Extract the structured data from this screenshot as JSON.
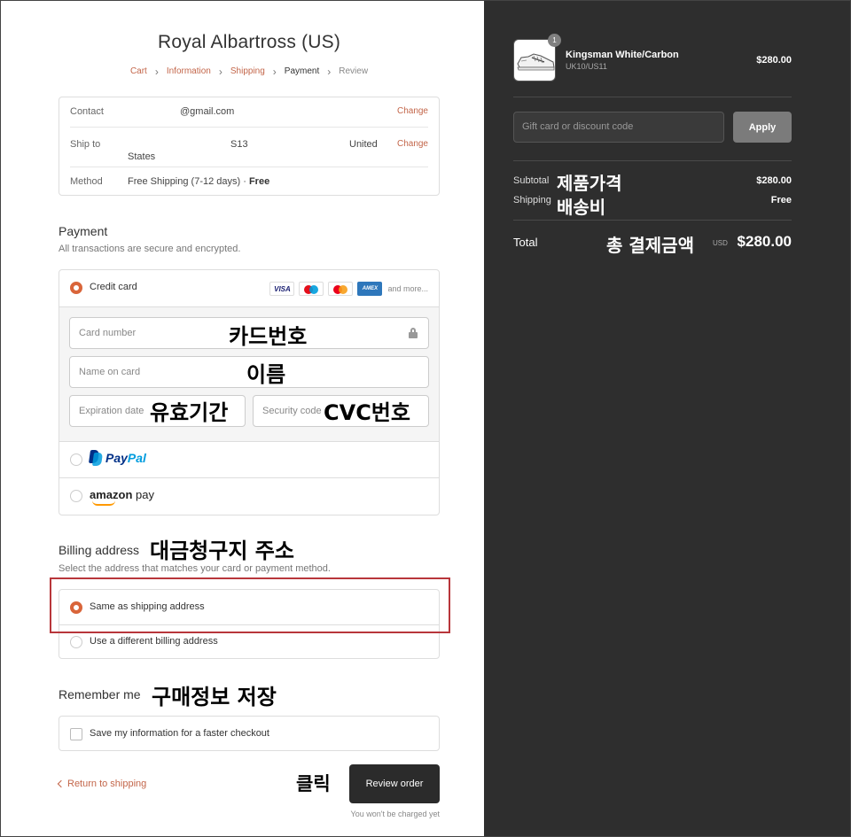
{
  "store": {
    "title": "Royal Albartross (US)"
  },
  "breadcrumb": {
    "cart": "Cart",
    "information": "Information",
    "shipping": "Shipping",
    "payment": "Payment",
    "review": "Review",
    "separator": "›"
  },
  "info": {
    "contact_label": "Contact",
    "contact_value": "@gmail.com",
    "ship_label": "Ship to",
    "ship_s13": "S13",
    "ship_united": "United",
    "ship_states": "States",
    "method_label": "Method",
    "method_value": "Free Shipping (7-12 days) · ",
    "method_free": "Free",
    "change": "Change"
  },
  "payment": {
    "title": "Payment",
    "subtitle": "All transactions are secure and encrypted.",
    "credit_card_label": "Credit card",
    "card_logos": {
      "visa": "VISA",
      "amex": "AMEX",
      "and_more": "and more..."
    },
    "card_number_placeholder": "Card number",
    "name_on_card_placeholder": "Name on card",
    "expiration_placeholder": "Expiration date",
    "security_placeholder": "Security code",
    "paypal": {
      "pay": "Pay",
      "pal": "Pal"
    },
    "amazon": {
      "amazon": "amazon",
      "pay": "pay"
    }
  },
  "billing": {
    "title": "Billing address",
    "subtitle": "Select the address that matches your card or payment method.",
    "same_label": "Same as shipping address",
    "different_label": "Use a different billing address"
  },
  "remember": {
    "title": "Remember me",
    "save_label": "Save my information for a faster checkout"
  },
  "actions": {
    "return_label": "Return to shipping",
    "review_label": "Review order",
    "charged_note": "You won't be charged yet"
  },
  "summary": {
    "product_name": "Kingsman White/Carbon",
    "product_variant": "UK10/US11",
    "product_price": "$280.00",
    "quantity": "1",
    "gift_placeholder": "Gift card or discount code",
    "apply_label": "Apply",
    "subtotal_label": "Subtotal",
    "subtotal_value": "$280.00",
    "shipping_label": "Shipping",
    "shipping_value": "Free",
    "total_label": "Total",
    "total_currency": "USD",
    "total_value": "$280.00"
  },
  "annotations": {
    "card_number": "카드번호",
    "name": "이름",
    "expiry": "유효기간",
    "cvc": "CVC번호",
    "billing": "대금청구지  주소",
    "remember": "구매정보  저장",
    "click": "클릭",
    "product_price": "제품가격",
    "shipping_fee": "배송비",
    "total": "총  결제금액"
  },
  "colors": {
    "accent": "#d9653a",
    "link": "#c3664a",
    "sidebar_bg": "#2e2e2e",
    "highlight_frame": "#b8363b"
  }
}
